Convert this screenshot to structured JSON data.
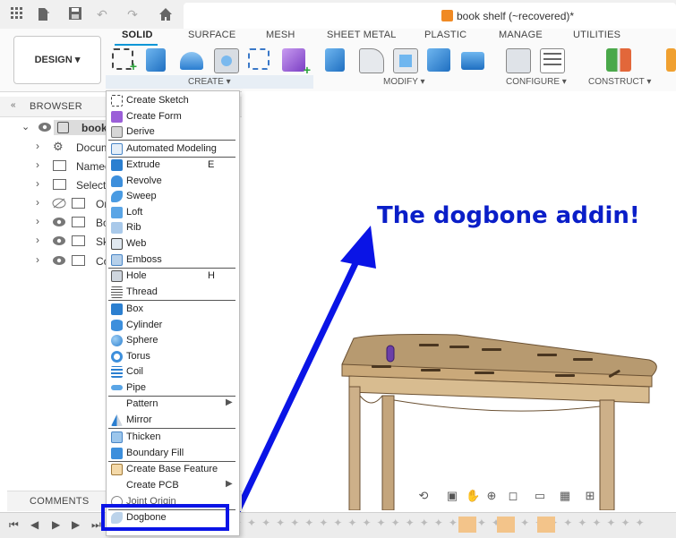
{
  "app": {
    "document_title": "book shelf (~recovered)*",
    "workspace_label": "DESIGN"
  },
  "ribbon": {
    "tabs": [
      "SOLID",
      "SURFACE",
      "MESH",
      "SHEET METAL",
      "PLASTIC",
      "MANAGE",
      "UTILITIES"
    ],
    "groups": [
      "CREATE",
      "MODIFY",
      "CONFIGURE",
      "CONSTRUCT"
    ]
  },
  "browser": {
    "title": "BROWSER",
    "items": [
      {
        "label": "book"
      },
      {
        "label": "Docum"
      },
      {
        "label": "Named"
      },
      {
        "label": "Selecti"
      },
      {
        "label": "Or"
      },
      {
        "label": "Bo"
      },
      {
        "label": "Sk"
      },
      {
        "label": "Co"
      }
    ]
  },
  "comments": {
    "title": "COMMENTS"
  },
  "create_menu": {
    "items": [
      {
        "label": "Create Sketch",
        "icon": "create-sketch-icon"
      },
      {
        "label": "Create Form",
        "icon": "create-form-icon"
      },
      {
        "label": "Derive",
        "icon": "derive-icon"
      },
      {
        "label": "Automated Modeling",
        "icon": "automated-modeling-icon"
      },
      {
        "label": "Extrude",
        "shortcut": "E",
        "icon": "extrude-icon"
      },
      {
        "label": "Revolve",
        "icon": "revolve-icon"
      },
      {
        "label": "Sweep",
        "icon": "sweep-icon"
      },
      {
        "label": "Loft",
        "icon": "loft-icon"
      },
      {
        "label": "Rib",
        "icon": "rib-icon"
      },
      {
        "label": "Web",
        "icon": "web-icon"
      },
      {
        "label": "Emboss",
        "icon": "emboss-icon"
      },
      {
        "label": "Hole",
        "shortcut": "H",
        "icon": "hole-icon"
      },
      {
        "label": "Thread",
        "icon": "thread-icon"
      },
      {
        "label": "Box",
        "icon": "box-icon"
      },
      {
        "label": "Cylinder",
        "icon": "cylinder-icon"
      },
      {
        "label": "Sphere",
        "icon": "sphere-icon"
      },
      {
        "label": "Torus",
        "icon": "torus-icon"
      },
      {
        "label": "Coil",
        "icon": "coil-icon"
      },
      {
        "label": "Pipe",
        "icon": "pipe-icon"
      },
      {
        "label": "Pattern",
        "icon": "pattern-icon"
      },
      {
        "label": "Mirror",
        "icon": "mirror-icon"
      },
      {
        "label": "Thicken",
        "icon": "thicken-icon"
      },
      {
        "label": "Boundary Fill",
        "icon": "boundary-fill-icon"
      },
      {
        "label": "Create Base Feature",
        "icon": "create-base-feature-icon"
      },
      {
        "label": "Create PCB",
        "icon": "create-pcb-icon"
      },
      {
        "label": "Joint Origin",
        "icon": "joint-origin-icon"
      },
      {
        "label": "Dogbone",
        "icon": "dogbone-icon"
      }
    ]
  },
  "annotation": {
    "text": "The dogbone addin!",
    "color": "#0a1ec8"
  },
  "colors": {
    "accent": "#0696d7",
    "annotation_blue": "#0a14e6"
  }
}
